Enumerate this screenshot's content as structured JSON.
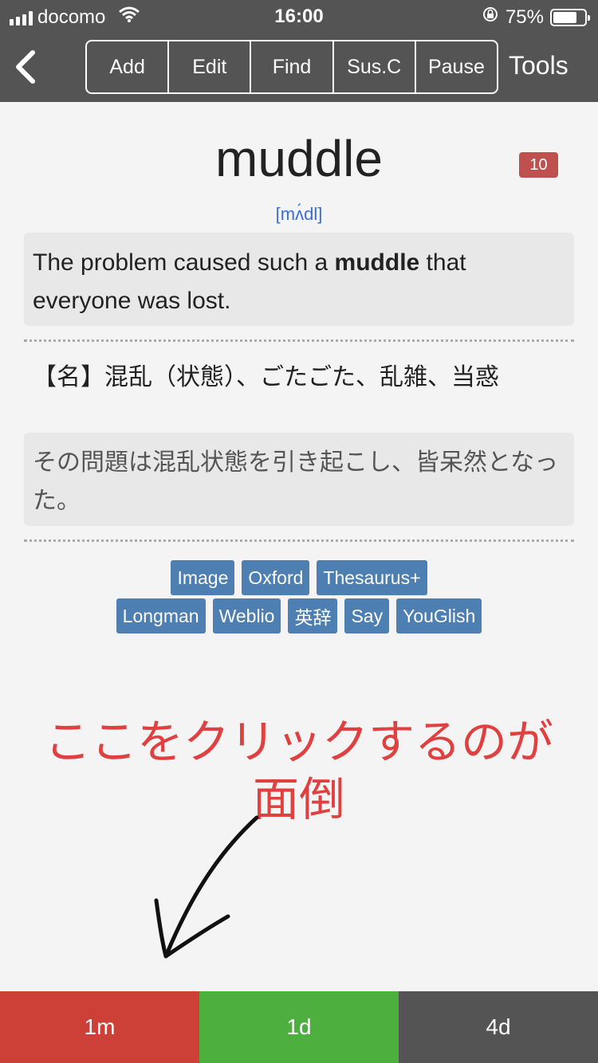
{
  "status_bar": {
    "carrier": "docomo",
    "time": "16:00",
    "battery_percent": "75%",
    "battery_level": 0.75,
    "icons": [
      "signal-icon",
      "wifi-icon",
      "rotation-lock-icon",
      "battery-icon"
    ]
  },
  "nav": {
    "back_icon": "chevron-left-icon",
    "segments": [
      "Add",
      "Edit",
      "Find",
      "Sus.C",
      "Pause"
    ],
    "tools": "Tools"
  },
  "card": {
    "word": "muddle",
    "badge_count": "10",
    "pronunciation": "[mʌ́dl]",
    "example_before": "The problem caused such a ",
    "example_bold": "muddle",
    "example_after": " that everyone was lost.",
    "meaning": "【名】混乱（状態）、ごたごた、乱雑、当惑",
    "example_translation": "その問題は混乱状態を引き起こし、皆呆然となった。"
  },
  "links": {
    "row1": [
      "Image",
      "Oxford",
      "Thesaurus+"
    ],
    "row2": [
      "Longman",
      "Weblio",
      "英辞",
      "Say",
      "YouGlish"
    ]
  },
  "annotation": {
    "line1": "ここをクリックするのが",
    "line2": "面倒",
    "color": "#e04040"
  },
  "answer_buttons": {
    "again": "1m",
    "good": "1d",
    "easy": "4d",
    "colors": {
      "again": "#cd4037",
      "good": "#4caf3e",
      "easy": "#545454"
    }
  }
}
